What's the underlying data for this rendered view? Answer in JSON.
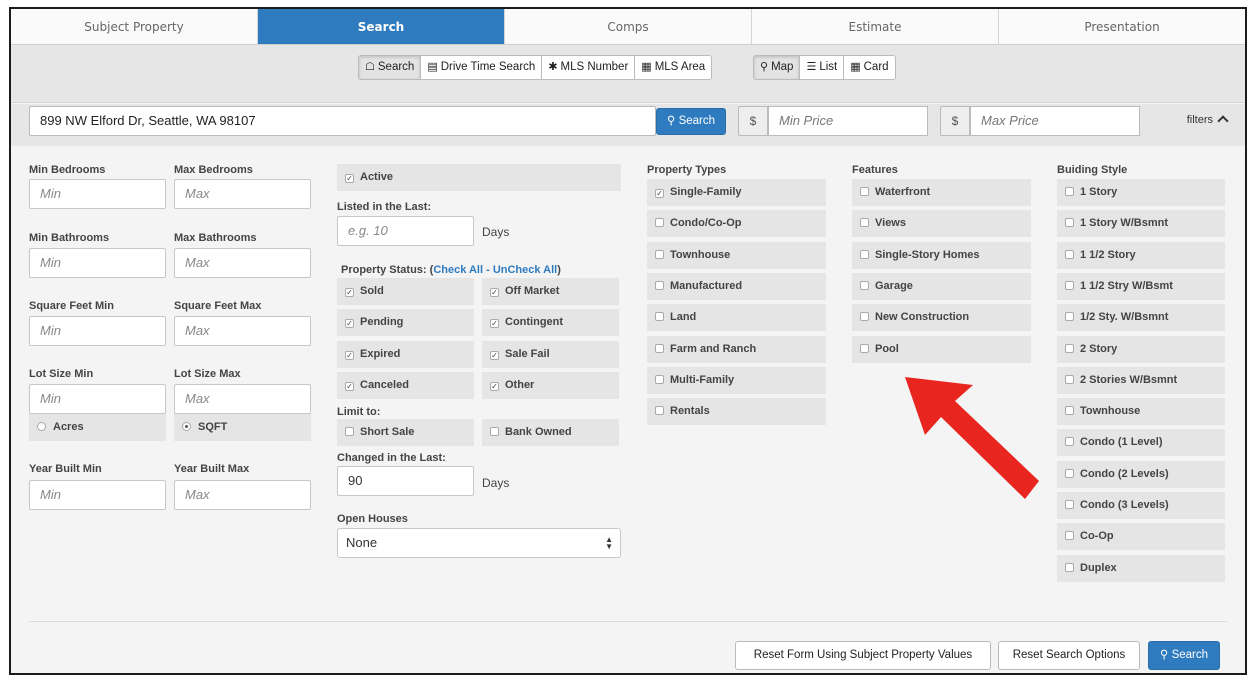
{
  "tabs": [
    "Subject Property",
    "Search",
    "Comps",
    "Estimate",
    "Presentation"
  ],
  "mode_buttons": {
    "search": "Search",
    "drive_time": "Drive Time Search",
    "mls_number": "MLS Number",
    "mls_area": "MLS Area",
    "map": "Map",
    "list": "List",
    "card": "Card"
  },
  "search_bar": {
    "address": "899 NW Elford Dr, Seattle, WA 98107",
    "search_button": "Search",
    "currency": "$",
    "min_price_placeholder": "Min Price",
    "max_price_placeholder": "Max Price",
    "filters_label": "filters"
  },
  "ranges": {
    "min_bedrooms": "Min Bedrooms",
    "max_bedrooms": "Max Bedrooms",
    "min_bathrooms": "Min Bathrooms",
    "max_bathrooms": "Max Bathrooms",
    "sqft_min": "Square Feet Min",
    "sqft_max": "Square Feet Max",
    "lot_min": "Lot Size Min",
    "lot_max": "Lot Size Max",
    "year_min": "Year Built Min",
    "year_max": "Year Built Max",
    "min_ph": "Min",
    "max_ph": "Max",
    "acres": "Acres",
    "sqft": "SQFT"
  },
  "status": {
    "active": "Active",
    "listed_label": "Listed in the Last:",
    "listed_placeholder": "e.g. 10",
    "days": "Days",
    "property_status_label": "Property Status:",
    "check_all": "Check All",
    "dash": " - ",
    "uncheck_all": "UnCheck All",
    "open_paren": "(",
    "close_paren": ")",
    "sold": "Sold",
    "off_market": "Off Market",
    "pending": "Pending",
    "contingent": "Contingent",
    "expired": "Expired",
    "sale_fail": "Sale Fail",
    "canceled": "Canceled",
    "other": "Other",
    "limit_to": "Limit to:",
    "short_sale": "Short Sale",
    "bank_owned": "Bank Owned",
    "changed_label": "Changed in the Last:",
    "changed_value": "90",
    "open_houses_label": "Open Houses",
    "open_houses_value": "None"
  },
  "property_types": {
    "label": "Property Types",
    "items": [
      "Single-Family",
      "Condo/Co-Op",
      "Townhouse",
      "Manufactured",
      "Land",
      "Farm and Ranch",
      "Multi-Family",
      "Rentals"
    ],
    "checked": [
      true,
      false,
      false,
      false,
      false,
      false,
      false,
      false
    ]
  },
  "features": {
    "label": "Features",
    "items": [
      "Waterfront",
      "Views",
      "Single-Story Homes",
      "Garage",
      "New Construction",
      "Pool"
    ]
  },
  "building_style": {
    "label": "Buiding Style",
    "items": [
      "1 Story",
      "1 Story W/Bsmnt",
      "1 1/2 Story",
      "1 1/2 Stry W/Bsmt",
      "1/2 Sty. W/Bsmnt",
      "2 Story",
      "2 Stories W/Bsmnt",
      "Townhouse",
      "Condo (1 Level)",
      "Condo (2 Levels)",
      "Condo (3 Levels)",
      "Co-Op",
      "Duplex"
    ]
  },
  "footer": {
    "reset_subject": "Reset Form Using Subject Property Values",
    "reset_search": "Reset Search Options",
    "search": "Search"
  },
  "colors": {
    "accent": "#2f7bbf",
    "arrow": "#e8261f"
  }
}
